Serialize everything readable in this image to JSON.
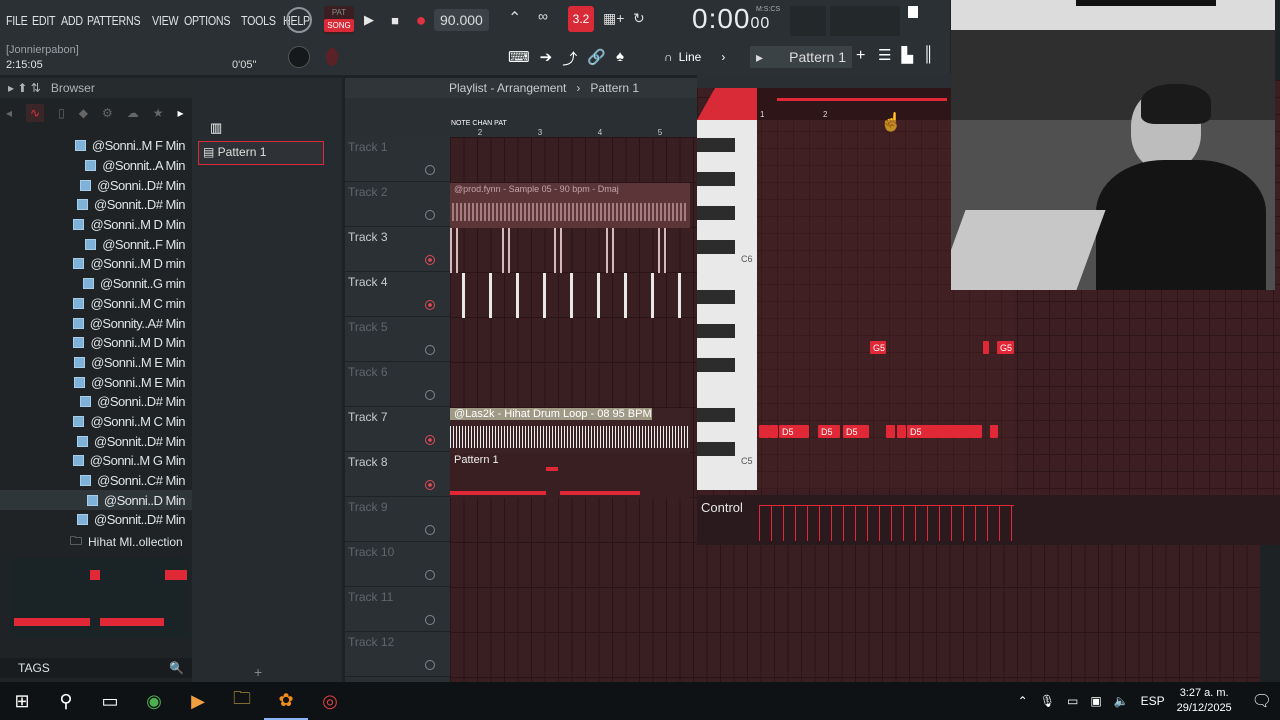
{
  "menu": [
    "FILE",
    "EDIT",
    "ADD",
    "PATTERNS",
    "VIEW",
    "OPTIONS",
    "TOOLS",
    "HELP"
  ],
  "transport": {
    "pat_label": "PAT",
    "song_label": "SONG",
    "tempo": "90.000",
    "time": "0:00",
    "time_small": "00",
    "time_format": "M:S:CS",
    "step_value": "3.2"
  },
  "hint": {
    "title": "[Jonnierpabon]",
    "time": "2:15:05",
    "position": "0'05\""
  },
  "toolbar2": {
    "snap": "Line",
    "pattern": "Pattern 1"
  },
  "browser": {
    "title": "Browser",
    "items": [
      "@Sonni..M F Min",
      "@Sonnit..A Min",
      "@Sonni..D# Min",
      "@Sonnit..D# Min",
      "@Sonni..M D Min",
      "@Sonnit..F Min",
      "@Sonni..M D min",
      "@Sonnit..G min",
      "@Sonni..M C min",
      "@Sonnity..A# Min",
      "@Sonni..M D Min",
      "@Sonni..M E Min",
      "@Sonni..M E Min",
      "@Sonni..D# Min",
      "@Sonni..M C Min",
      "@Sonnit..D# Min",
      "@Sonni..M G Min",
      "@Sonni..C# Min",
      "@Sonni..D Min",
      "@Sonnit..D# Min"
    ],
    "folder": "Hihat Ml..ollection",
    "tags": "TAGS"
  },
  "pattern_list": {
    "item": "Pattern 1"
  },
  "playlist": {
    "title": "Playlist - Arrangement",
    "pattern": "Pattern 1",
    "ruler": [
      "2",
      "3",
      "4",
      "5"
    ],
    "tracks": [
      "Track 1",
      "Track 2",
      "Track 3",
      "Track 4",
      "Track 5",
      "Track 6",
      "Track 7",
      "Track 8",
      "Track 9",
      "Track 10",
      "Track 11",
      "Track 12"
    ],
    "clips": {
      "track2": "@prod.fynn - Sample 05 - 90 bpm - Dmaj",
      "track7": "@Las2k - Hihat Drum Loop - 08 95 BPM",
      "track8": "Pattern 1"
    }
  },
  "piano": {
    "c6": "C6",
    "c5": "C5",
    "ruler": [
      "1",
      "2"
    ],
    "notes": [
      "G5",
      "G5",
      "D5",
      "D5",
      "D5",
      "D5"
    ],
    "control": "Control"
  },
  "taskbar": {
    "lang": "ESP",
    "time": "3:27 a. m.",
    "date": "29/12/2025"
  }
}
